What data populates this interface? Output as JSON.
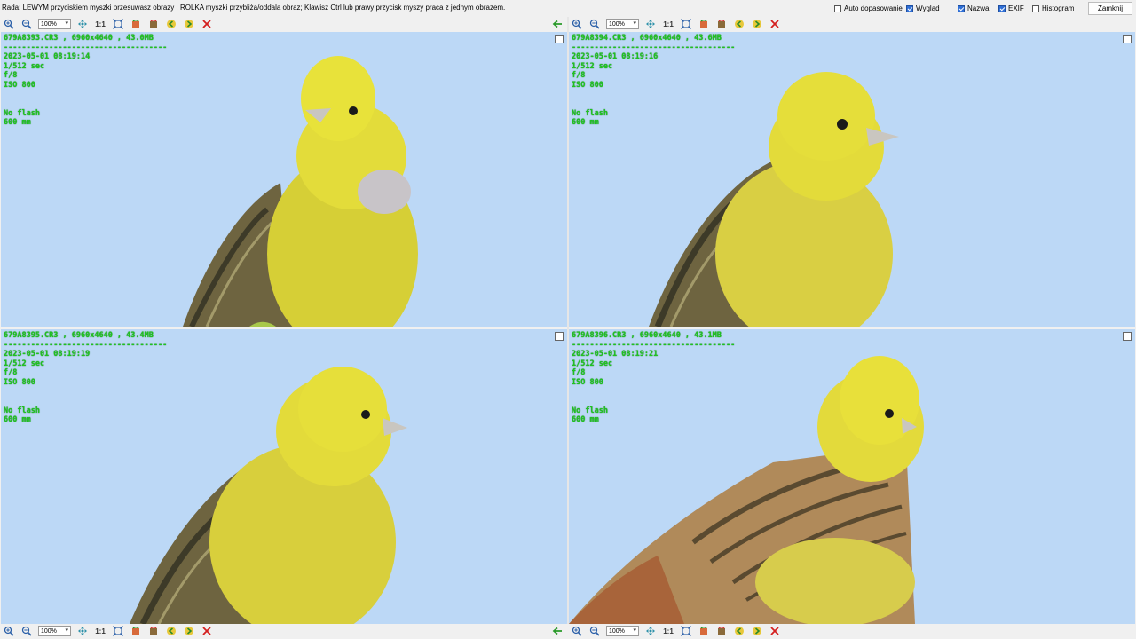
{
  "topbar": {
    "hint": "Rada: LEWYM przyciskiem myszki przesuwasz obrazy ; ROLKA myszki przybliża/oddala obraz; Klawisz Ctrl lub prawy przycisk myszy praca z jednym obrazem.",
    "options": [
      {
        "label": "Auto dopasowanie",
        "checked": false
      },
      {
        "label": "Wygląd",
        "checked": true
      },
      {
        "label": "Nazwa",
        "checked": true
      },
      {
        "label": "EXIF",
        "checked": true
      },
      {
        "label": "Histogram",
        "checked": false
      }
    ],
    "close_label": "Zamknij"
  },
  "toolbar": {
    "zoom_value": "100%",
    "one_to_one": "1:1",
    "icons": [
      "zoom-in-icon",
      "zoom-out-icon",
      "fit-icon",
      "rotate-left-icon",
      "rotate-right-icon",
      "prev-image-icon",
      "next-image-icon",
      "delete-icon"
    ]
  },
  "panes": [
    {
      "filename_line": "679A8393.CR3 , 6960x4640 , 43.0MB",
      "separator": "------------------------------------",
      "date": "2023-05-01 08:19:14",
      "shutter": "1/512 sec",
      "aperture": "f/8",
      "iso": "ISO 800",
      "flash": "No flash",
      "focal": "600 mm"
    },
    {
      "filename_line": "679A8394.CR3 , 6960x4640 , 43.6MB",
      "separator": "------------------------------------",
      "date": "2023-05-01 08:19:16",
      "shutter": "1/512 sec",
      "aperture": "f/8",
      "iso": "ISO 800",
      "flash": "No flash",
      "focal": "600 mm"
    },
    {
      "filename_line": "679A8395.CR3 , 6960x4640 , 43.4MB",
      "separator": "------------------------------------",
      "date": "2023-05-01 08:19:19",
      "shutter": "1/512 sec",
      "aperture": "f/8",
      "iso": "ISO 800",
      "flash": "No flash",
      "focal": "600 mm"
    },
    {
      "filename_line": "679A8396.CR3 , 6960x4640 , 43.1MB",
      "separator": "------------------------------------",
      "date": "2023-05-01 08:19:21",
      "shutter": "1/512 sec",
      "aperture": "f/8",
      "iso": "ISO 800",
      "flash": "No flash",
      "focal": "600 mm"
    }
  ],
  "colors": {
    "sky": "#bcd8f6",
    "overlay_text": "#1ec41e",
    "bird_yellow": "#e8e23a",
    "bird_wing": "#6e6440"
  }
}
